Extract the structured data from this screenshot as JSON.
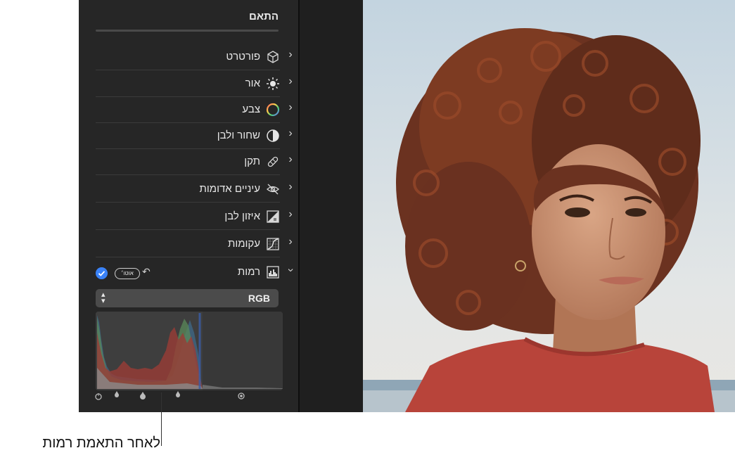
{
  "panel": {
    "title": "התאם",
    "rows": [
      {
        "label": "פורטרט",
        "icon": "cube-icon"
      },
      {
        "label": "אור",
        "icon": "sun-icon"
      },
      {
        "label": "צבע",
        "icon": "color-wheel-icon"
      },
      {
        "label": "שחור ולבן",
        "icon": "half-circle-icon"
      },
      {
        "label": "תקן",
        "icon": "bandage-icon"
      },
      {
        "label": "עיניים אדומות",
        "icon": "eye-slash-icon"
      },
      {
        "label": "איזון לבן",
        "icon": "white-balance-icon"
      },
      {
        "label": "עקומות",
        "icon": "curves-icon"
      }
    ],
    "levels": {
      "label": "רמות",
      "icon": "levels-icon",
      "auto_label": "אוטו׳",
      "undo_icon": "undo-icon",
      "check_icon": "checkmark-icon",
      "channel": "RGB",
      "accent": "#3a82f7"
    }
  },
  "callout": {
    "text": "לאחר התאמת רמות"
  }
}
